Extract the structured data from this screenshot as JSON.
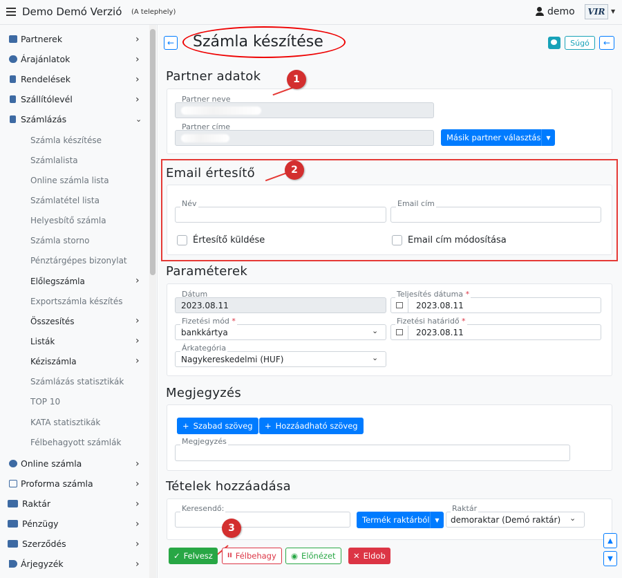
{
  "header": {
    "app_title": "Demo Demó Verzió",
    "subtitle": "(A telephely)",
    "user": "demo",
    "logo_text": "VIR"
  },
  "sidebar": {
    "items": [
      {
        "label": "Partnerek",
        "icon": "partner-icon"
      },
      {
        "label": "Árajánlatok",
        "icon": "chat-icon"
      },
      {
        "label": "Rendelések",
        "icon": "file-icon"
      },
      {
        "label": "Szállítólevél",
        "icon": "clipboard-icon"
      },
      {
        "label": "Számlázás",
        "icon": "invoice-icon"
      }
    ],
    "submenu": [
      {
        "label": "Számla készítése"
      },
      {
        "label": "Számlalista"
      },
      {
        "label": "Online számla lista"
      },
      {
        "label": "Számlatétel lista"
      },
      {
        "label": "Helyesbítő számla"
      },
      {
        "label": "Számla storno"
      },
      {
        "label": "Pénztárgépes bizonylat"
      },
      {
        "label": "Előlegszámla"
      },
      {
        "label": "Exportszámla készítés"
      },
      {
        "label": "Összesítés"
      },
      {
        "label": "Listák"
      },
      {
        "label": "Kéziszámla"
      },
      {
        "label": "Számlázás statisztikák"
      },
      {
        "label": "TOP 10"
      },
      {
        "label": "KATA statisztikák"
      },
      {
        "label": "Félbehagyott számlák"
      }
    ],
    "items_bottom": [
      {
        "label": "Online számla",
        "icon": "globe-icon"
      },
      {
        "label": "Proforma számla",
        "icon": "document-icon"
      },
      {
        "label": "Raktár",
        "icon": "warehouse-icon"
      },
      {
        "label": "Pénzügy",
        "icon": "money-icon"
      },
      {
        "label": "Szerződés",
        "icon": "contract-icon"
      },
      {
        "label": "Árjegyzék",
        "icon": "tag-icon"
      }
    ]
  },
  "page": {
    "title": "Számla készítése",
    "help_label": "Súgó"
  },
  "partner": {
    "section_title": "Partner adatok",
    "name_label": "Partner neve",
    "address_label": "Partner címe",
    "other_partner_button": "Másik partner választása"
  },
  "email": {
    "section_title": "Email értesítő",
    "name_label": "Név",
    "email_label": "Email cím",
    "send_label": "Értesítő küldése",
    "modify_label": "Email cím módosítása"
  },
  "params": {
    "section_title": "Paraméterek",
    "date_label": "Dátum",
    "date_value": "2023.08.11",
    "fulfillment_label": "Teljesítés dátuma",
    "fulfillment_value": "2023.08.11",
    "payment_label": "Fizetési mód",
    "payment_value": "bankkártya",
    "deadline_label": "Fizetési határidő",
    "deadline_value": "2023.08.11",
    "price_category_label": "Árkategória",
    "price_category_value": "Nagykereskedelmi (HUF)",
    "required_mark": "*"
  },
  "notes": {
    "section_title": "Megjegyzés",
    "free_text_button": "Szabad szöveg",
    "addable_text_button": "Hozzáadható szöveg",
    "notes_label": "Megjegyzés",
    "plus": "+"
  },
  "items": {
    "section_title": "Tételek hozzáadása",
    "search_label": "Keresendő:",
    "from_stock_button": "Termék raktárból",
    "warehouse_label": "Raktár",
    "warehouse_value": "demoraktar (Demó raktár)"
  },
  "actions": {
    "save": "Felvesz",
    "abandon": "Félbehagy",
    "preview": "Előnézet",
    "discard": "Eldob"
  },
  "markers": [
    "1",
    "2",
    "3"
  ],
  "colors": {
    "primary": "#007bff",
    "success": "#28a745",
    "danger": "#dc3545",
    "annotation": "#e53935"
  }
}
